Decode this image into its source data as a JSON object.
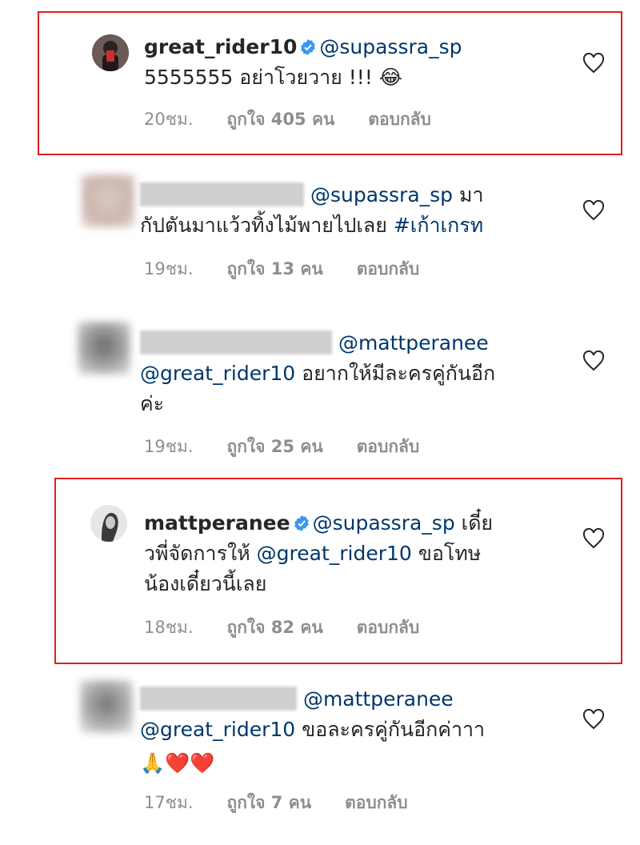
{
  "comments": [
    {
      "username": "great_rider10",
      "verified": true,
      "mention": "@supassra_sp",
      "line2": "5555555 อย่าโวยวาย !!! 😂",
      "time": "20ชม.",
      "likes": "ถูกใจ 405 คน",
      "reply": "ตอบกลับ",
      "highlighted": true
    },
    {
      "mention": "@supassra_sp",
      "line1_tail": "มา",
      "line2": "กัปตันมาแว้วทิ้งไม้พายไปเลย",
      "hashtag": "#เก้าเกรท",
      "time": "19ชม.",
      "likes": "ถูกใจ 13 คน",
      "reply": "ตอบกลับ"
    },
    {
      "mention": "@mattperanee",
      "line2_mention": "@great_rider10",
      "line2_tail": "อยากให้มีละครคู่กันอีก",
      "line3": "ค่ะ",
      "time": "19ชม.",
      "likes": "ถูกใจ 25 คน",
      "reply": "ตอบกลับ"
    },
    {
      "username": "mattperanee",
      "verified": true,
      "mention": "@supassra_sp",
      "line1_tail": "เดี๋ย",
      "line2_head": "วพี่จัดการให้",
      "line2_mention": "@great_rider10",
      "line2_tail": "ขอโทษ",
      "line3": "น้องเดี๋ยวนี้เลย",
      "time": "18ชม.",
      "likes": "ถูกใจ 82 คน",
      "reply": "ตอบกลับ",
      "highlighted": true
    },
    {
      "mention": "@mattperanee",
      "line2_mention": "@great_rider10",
      "line2_tail": "ขอละครคู่กันอีกค่าาา",
      "line3": "🙏❤️❤️",
      "time": "17ชม.",
      "likes": "ถูกใจ 7 คน",
      "reply": "ตอบกลับ"
    }
  ],
  "colors": {
    "text": "#262626",
    "mention": "#00376b",
    "meta": "#8e8e8e",
    "verified": "#3897f0",
    "highlight_border": "#e02020"
  },
  "icons": [
    "verified-badge-icon",
    "heart-icon"
  ]
}
